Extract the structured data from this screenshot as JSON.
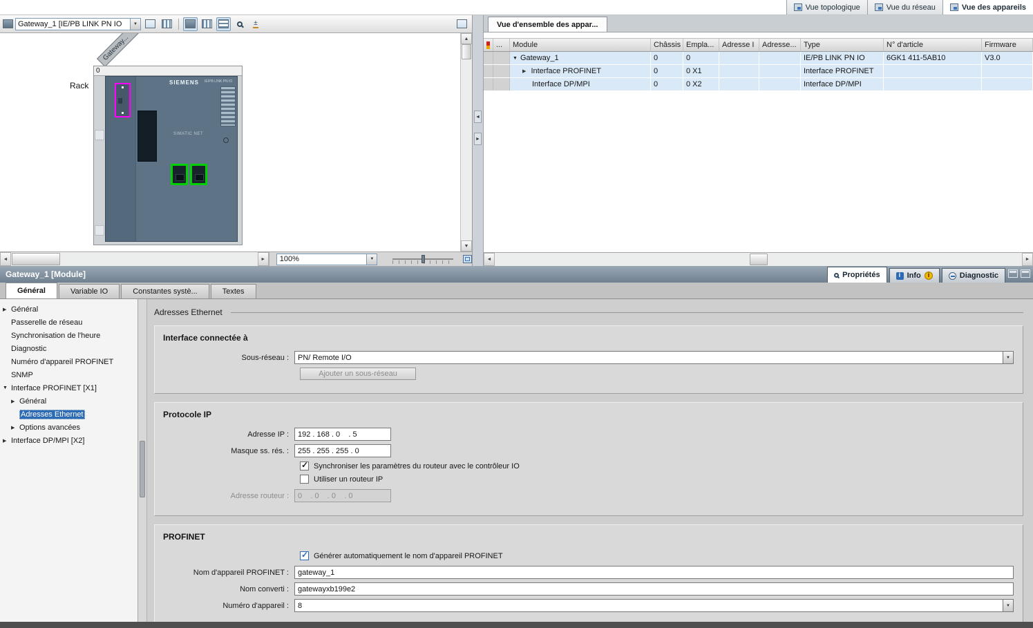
{
  "view_tabs": [
    {
      "label": "Vue topologique"
    },
    {
      "label": "Vue du réseau"
    },
    {
      "label": "Vue des appareils"
    }
  ],
  "device_view": {
    "device_select": "Gateway_1 [IE/PB LINK PN IO",
    "zoom": "100%",
    "rack_label": "Rack",
    "slot_number": "0",
    "diagonal_label": "Gateway...",
    "brand": "SIEMENS",
    "model": "IE/PB LINK PN IO",
    "net_label": "SIMATIC NET"
  },
  "overview": {
    "tab": "Vue d'ensemble des appar...",
    "columns": {
      "dots": "...",
      "module": "Module",
      "chassis": "Châssis",
      "slot": "Empla...",
      "addr_i": "Adresse I",
      "addr_q": "Adresse...",
      "type": "Type",
      "article": "N° d'article",
      "firmware": "Firmware"
    },
    "rows": [
      {
        "module": "Gateway_1",
        "chassis": "0",
        "slot": "0",
        "type": "IE/PB LINK PN IO",
        "article": "6GK1 411-5AB10",
        "firmware": "V3.0"
      },
      {
        "module": "Interface PROFINET",
        "chassis": "0",
        "slot": "0 X1",
        "type": "Interface PROFINET",
        "article": "",
        "firmware": ""
      },
      {
        "module": "Interface DP/MPI",
        "chassis": "0",
        "slot": "0 X2",
        "type": "Interface DP/MPI",
        "article": "",
        "firmware": ""
      }
    ]
  },
  "properties": {
    "title": "Gateway_1 [Module]",
    "panel_tabs": [
      {
        "label": "Propriétés"
      },
      {
        "label": "Info"
      },
      {
        "label": "Diagnostic"
      }
    ],
    "tabs": [
      {
        "label": "Général"
      },
      {
        "label": "Variable IO"
      },
      {
        "label": "Constantes systè..."
      },
      {
        "label": "Textes"
      }
    ],
    "nav": [
      {
        "label": "Général"
      },
      {
        "label": "Passerelle de réseau"
      },
      {
        "label": "Synchronisation de l'heure"
      },
      {
        "label": "Diagnostic"
      },
      {
        "label": "Numéro d'appareil PROFINET"
      },
      {
        "label": "SNMP"
      },
      {
        "label": "Interface PROFINET [X1]"
      },
      {
        "label": "Général"
      },
      {
        "label": "Adresses Ethernet"
      },
      {
        "label": "Options avancées"
      },
      {
        "label": "Interface DP/MPI [X2]"
      }
    ],
    "form": {
      "page_title": "Adresses Ethernet",
      "interface_section": {
        "title": "Interface connectée à",
        "subnet_label": "Sous-réseau :",
        "subnet_value": "PN/ Remote I/O",
        "add_subnet_button": "Ajouter un sous-réseau"
      },
      "ip_section": {
        "title": "Protocole IP",
        "ip_label": "Adresse IP :",
        "ip_value": "192 . 168 . 0    . 5",
        "mask_label": "Masque ss. rés. :",
        "mask_value": "255 . 255 . 255 . 0",
        "sync_router_checkbox": "Synchroniser les paramètres du routeur avec le contrôleur IO",
        "use_router_checkbox": "Utiliser un routeur IP",
        "router_label": "Adresse routeur :",
        "router_value": "0    . 0    . 0    . 0"
      },
      "profinet_section": {
        "title": "PROFINET",
        "auto_name_checkbox": "Générer automatiquement le nom d'appareil PROFINET",
        "device_name_label": "Nom d'appareil PROFINET :",
        "device_name_value": "gateway_1",
        "converted_name_label": "Nom converti :",
        "converted_name_value": "gatewayxb199e2",
        "device_number_label": "Numéro d'appareil :",
        "device_number_value": "8"
      }
    }
  }
}
